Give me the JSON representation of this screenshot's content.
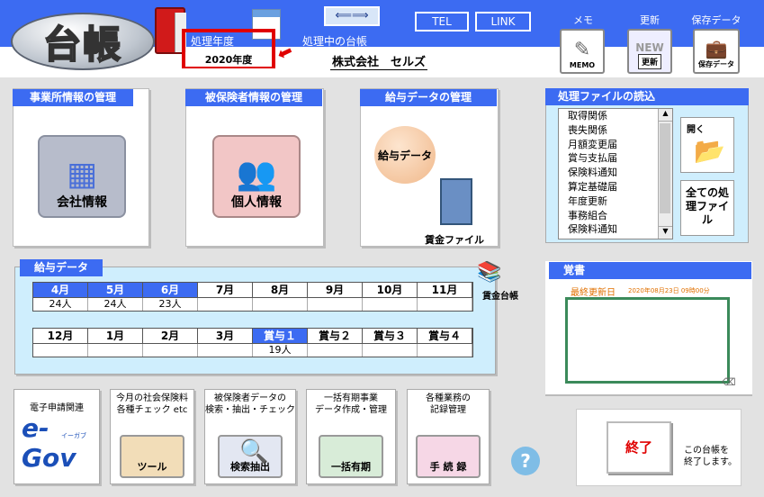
{
  "header": {
    "logo_text": "台帳",
    "arrows_label": "⟸⟹",
    "fy_label": "処理年度",
    "fy_value": "2020年度",
    "current_label": "処理中の台帳",
    "company": "株式会社　セルズ",
    "tel": "TEL",
    "link": "LINK",
    "memo_label": "メモ",
    "memo_icon_text": "MEMO",
    "update_label": "更新",
    "update_icon_text": "更新",
    "new_badge": "NEW",
    "save_label": "保存データ",
    "save_icon_text": "保存データ"
  },
  "sections": {
    "office": {
      "title": "事業所情報の管理",
      "button": "会社情報"
    },
    "insured": {
      "title": "被保険者情報の管理",
      "button": "個人情報"
    },
    "salary": {
      "title": "給与データの管理",
      "button": "給与データ",
      "wage_file": "賃金ファイル"
    },
    "files": {
      "title": "処理ファイルの読込",
      "items": [
        "取得関係",
        "喪失関係",
        "月額変更届",
        "賞与支払届",
        "保険料通知",
        "算定基礎届",
        "年度更新",
        "事務組合",
        "保険料通知"
      ],
      "open": "開く",
      "all_files": "全ての処理ファイル"
    }
  },
  "salary_table": {
    "title": "給与データ",
    "ledger": "賃金台帳",
    "row1": [
      {
        "m": "4月",
        "v": "24人",
        "hl": true
      },
      {
        "m": "5月",
        "v": "24人",
        "hl": true
      },
      {
        "m": "6月",
        "v": "23人",
        "hl": true
      },
      {
        "m": "7月",
        "v": "",
        "hl": false
      },
      {
        "m": "8月",
        "v": "",
        "hl": false
      },
      {
        "m": "9月",
        "v": "",
        "hl": false
      },
      {
        "m": "10月",
        "v": "",
        "hl": false
      },
      {
        "m": "11月",
        "v": "",
        "hl": false
      }
    ],
    "row2": [
      {
        "m": "12月",
        "v": "",
        "hl": false
      },
      {
        "m": "1月",
        "v": "",
        "hl": false
      },
      {
        "m": "2月",
        "v": "",
        "hl": false
      },
      {
        "m": "3月",
        "v": "",
        "hl": false
      },
      {
        "m": "賞与１",
        "v": "19人",
        "hl": true
      },
      {
        "m": "賞与２",
        "v": "",
        "hl": false
      },
      {
        "m": "賞与３",
        "v": "",
        "hl": false
      },
      {
        "m": "賞与４",
        "v": "",
        "hl": false
      }
    ]
  },
  "memo": {
    "title": "覚書",
    "updated_label": "最終更新日",
    "updated_value": "2020年08月23日 09時00分"
  },
  "bottom": [
    {
      "title": "電子申請関連",
      "icon": "e-Gov",
      "icon_sub": "イーガブ"
    },
    {
      "title": "今月の社会保険料\n各種チェック etc",
      "icon": "ツール"
    },
    {
      "title": "被保険者データの\n検索・抽出・チェック",
      "icon": "検索抽出"
    },
    {
      "title": "一括有期事業\nデータ作成・管理",
      "icon": "一括有期"
    },
    {
      "title": "各種業務の\n記録管理",
      "icon": "手 続 録"
    }
  ],
  "help": "?",
  "exit": {
    "button": "終了",
    "desc": "この台帳を\n終了します。"
  }
}
